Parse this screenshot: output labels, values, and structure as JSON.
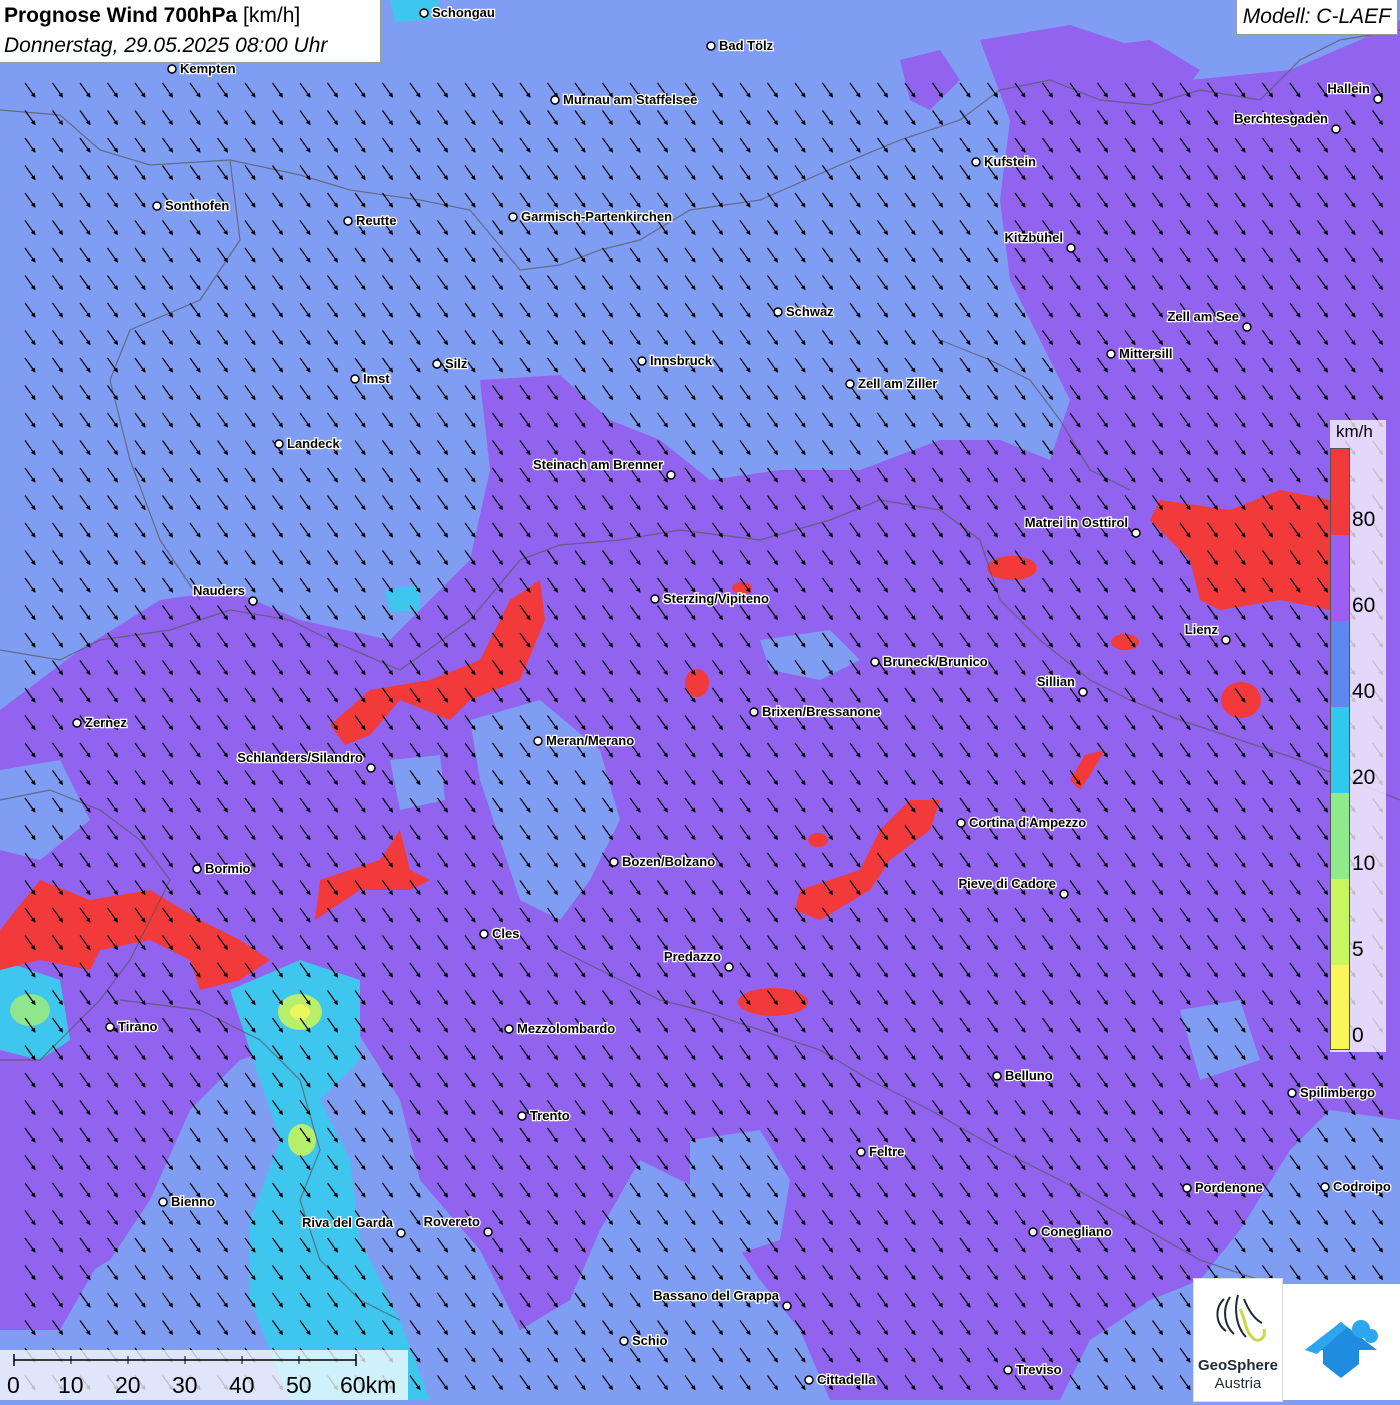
{
  "header": {
    "title_bold": "Prognose Wind 700hPa",
    "title_unit": "[km/h]",
    "datetime": "Donnerstag, 29.05.2025 08:00 Uhr",
    "model": "Modell: C-LAEF"
  },
  "legend": {
    "unit": "km/h",
    "labels": [
      "80",
      "60",
      "40",
      "20",
      "10",
      "5",
      "0"
    ],
    "colors": [
      "#f23a3a",
      "#9d5ef2",
      "#5f87f0",
      "#31c8f0",
      "#8fea8a",
      "#c8f560",
      "#f7f55a"
    ]
  },
  "scale_bar": {
    "labels": [
      "0",
      "10",
      "20",
      "30",
      "40",
      "50",
      "60km"
    ]
  },
  "logos": {
    "geosphere_line1": "GeoSphere",
    "geosphere_line2": "Austria"
  },
  "cities": [
    {
      "name": "Schongau"
    },
    {
      "name": "Bad Tölz"
    },
    {
      "name": "Kempten"
    },
    {
      "name": "Murnau am Staffelsee"
    },
    {
      "name": "Hallein"
    },
    {
      "name": "Berchtesgaden"
    },
    {
      "name": "Kufstein"
    },
    {
      "name": "Sonthofen"
    },
    {
      "name": "Reutte"
    },
    {
      "name": "Garmisch-Partenkirchen"
    },
    {
      "name": "Kitzbühel"
    },
    {
      "name": "Schwaz"
    },
    {
      "name": "Zell am See"
    },
    {
      "name": "Mittersill"
    },
    {
      "name": "Silz"
    },
    {
      "name": "Innsbruck"
    },
    {
      "name": "Imst"
    },
    {
      "name": "Zell am Ziller"
    },
    {
      "name": "Landeck"
    },
    {
      "name": "Steinach am Brenner"
    },
    {
      "name": "Matrei in Osttirol"
    },
    {
      "name": "Nauders"
    },
    {
      "name": "Sterzing/Vipiteno"
    },
    {
      "name": "Lienz"
    },
    {
      "name": "Bruneck/Brunico"
    },
    {
      "name": "Sillian"
    },
    {
      "name": "Zernez"
    },
    {
      "name": "Brixen/Bressanone"
    },
    {
      "name": "Meran/Merano"
    },
    {
      "name": "Schlanders/Silandro"
    },
    {
      "name": "Cortina d'Ampezzo"
    },
    {
      "name": "Bozen/Bolzano"
    },
    {
      "name": "Bormio"
    },
    {
      "name": "Pieve di Cadore"
    },
    {
      "name": "Cles"
    },
    {
      "name": "Predazzo"
    },
    {
      "name": "Tirano"
    },
    {
      "name": "Mezzolombardo"
    },
    {
      "name": "Belluno"
    },
    {
      "name": "Spilimbergo"
    },
    {
      "name": "Trento"
    },
    {
      "name": "Feltre"
    },
    {
      "name": "Pordenone"
    },
    {
      "name": "Codroipo"
    },
    {
      "name": "Bienno"
    },
    {
      "name": "Riva del Garda"
    },
    {
      "name": "Rovereto"
    },
    {
      "name": "Conegliano"
    },
    {
      "name": "Bassano del Grappa"
    },
    {
      "name": "Schio"
    },
    {
      "name": "Treviso"
    },
    {
      "name": "Cittadella"
    }
  ]
}
